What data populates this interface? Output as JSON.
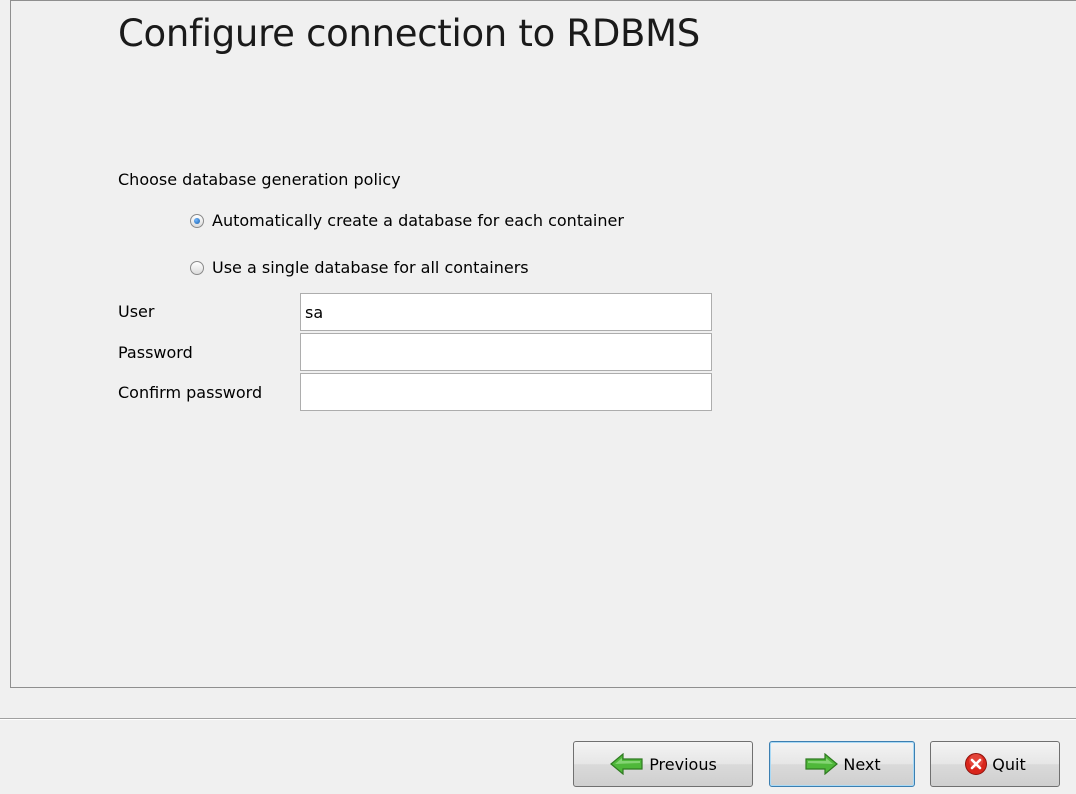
{
  "page": {
    "title": "Configure connection to RDBMS"
  },
  "policy": {
    "label": "Choose database generation policy",
    "options": [
      {
        "label": "Automatically create a database for each container",
        "selected": true
      },
      {
        "label": "Use a single database for all containers",
        "selected": false
      }
    ]
  },
  "fields": {
    "user": {
      "label": "User",
      "value": "sa"
    },
    "password": {
      "label": "Password",
      "value": ""
    },
    "confirm_password": {
      "label": "Confirm password",
      "value": ""
    }
  },
  "buttons": {
    "previous": {
      "label": "Previous",
      "icon": "arrow-left-icon"
    },
    "next": {
      "label": "Next",
      "icon": "arrow-right-icon"
    },
    "quit": {
      "label": "Quit",
      "icon": "close-circle-icon"
    }
  },
  "colors": {
    "arrow_green": "#4fb83a",
    "quit_red": "#d9261c"
  }
}
